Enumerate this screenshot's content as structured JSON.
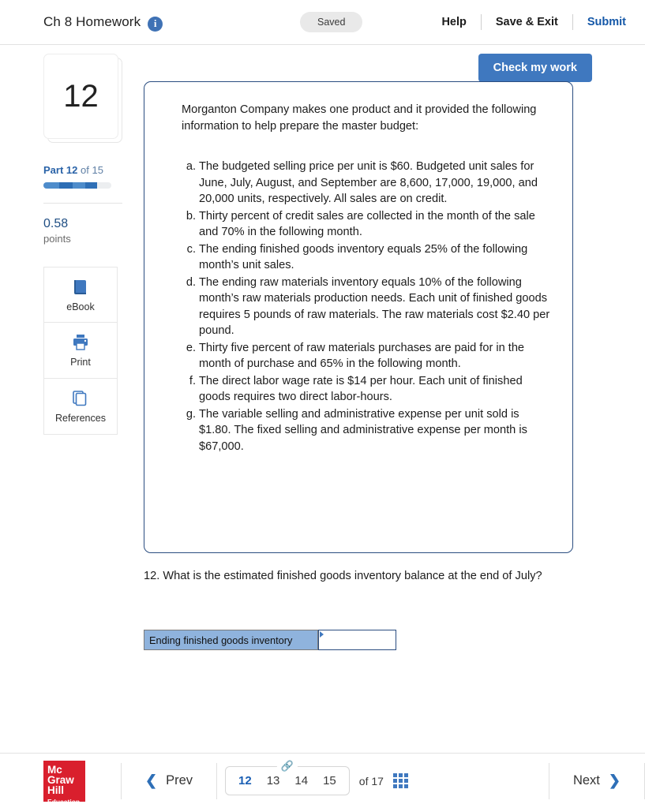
{
  "header": {
    "title": "Ch 8 Homework",
    "info_icon": "info-icon",
    "saved_badge": "Saved",
    "links": [
      {
        "label": "Help",
        "style": "dark"
      },
      {
        "label": "Save & Exit",
        "style": "dark"
      },
      {
        "label": "Submit",
        "style": "blue"
      }
    ]
  },
  "toolbar": {
    "check_my_work": "Check my work"
  },
  "sidebar": {
    "question_number": "12",
    "part_prefix": "Part",
    "part_current": "12",
    "part_of": "of 15",
    "progress_percent": 80,
    "points_value": "0.58",
    "points_label": "points",
    "tools": [
      {
        "label": "eBook",
        "icon": "book-icon"
      },
      {
        "label": "Print",
        "icon": "printer-icon"
      },
      {
        "label": "References",
        "icon": "copy-pages-icon"
      }
    ]
  },
  "main": {
    "intro": "Morganton Company makes one product and it provided the following information to help prepare the master budget:",
    "facts": [
      "The budgeted selling price per unit is $60. Budgeted unit sales for June, July, August, and September are 8,600, 17,000, 19,000, and 20,000 units, respectively. All sales are on credit.",
      "Thirty percent of credit sales are collected in the month of the sale and 70% in the following month.",
      "The ending finished goods inventory equals 25% of the following month’s unit sales.",
      "The ending raw materials inventory equals 10% of the following month’s raw materials production needs. Each unit of finished goods requires 5 pounds of raw materials. The raw materials cost $2.40 per pound.",
      "Thirty five percent of raw materials purchases are paid for in the month of purchase and 65% in the following month.",
      "The direct labor wage rate is $14 per hour. Each unit of finished goods requires two direct labor-hours.",
      "The variable selling and administrative expense per unit sold is $1.80. The fixed selling and administrative expense per month is $67,000."
    ],
    "question": "12. What is the estimated finished goods inventory balance at the end of July?",
    "answer_label": "Ending finished goods inventory",
    "answer_value": "",
    "answer_placeholder": ""
  },
  "footer": {
    "logo_line1": "Mc",
    "logo_line2": "Graw",
    "logo_line3": "Hill",
    "logo_line4": "Education",
    "prev_label": "Prev",
    "next_label": "Next",
    "link_icon": "chain-link-icon",
    "pages": [
      {
        "number": "12",
        "active": true
      },
      {
        "number": "13",
        "active": false
      },
      {
        "number": "14",
        "active": false
      },
      {
        "number": "15",
        "active": false
      }
    ],
    "of_total": "of 17",
    "grid_icon": "grid-menu-icon"
  },
  "colors": {
    "accent_blue": "#3f78bf",
    "link_blue": "#1558a8",
    "box_border": "#2a4d80",
    "answer_label_bg": "#8fb3dd",
    "logo_red": "#d91f2d"
  }
}
